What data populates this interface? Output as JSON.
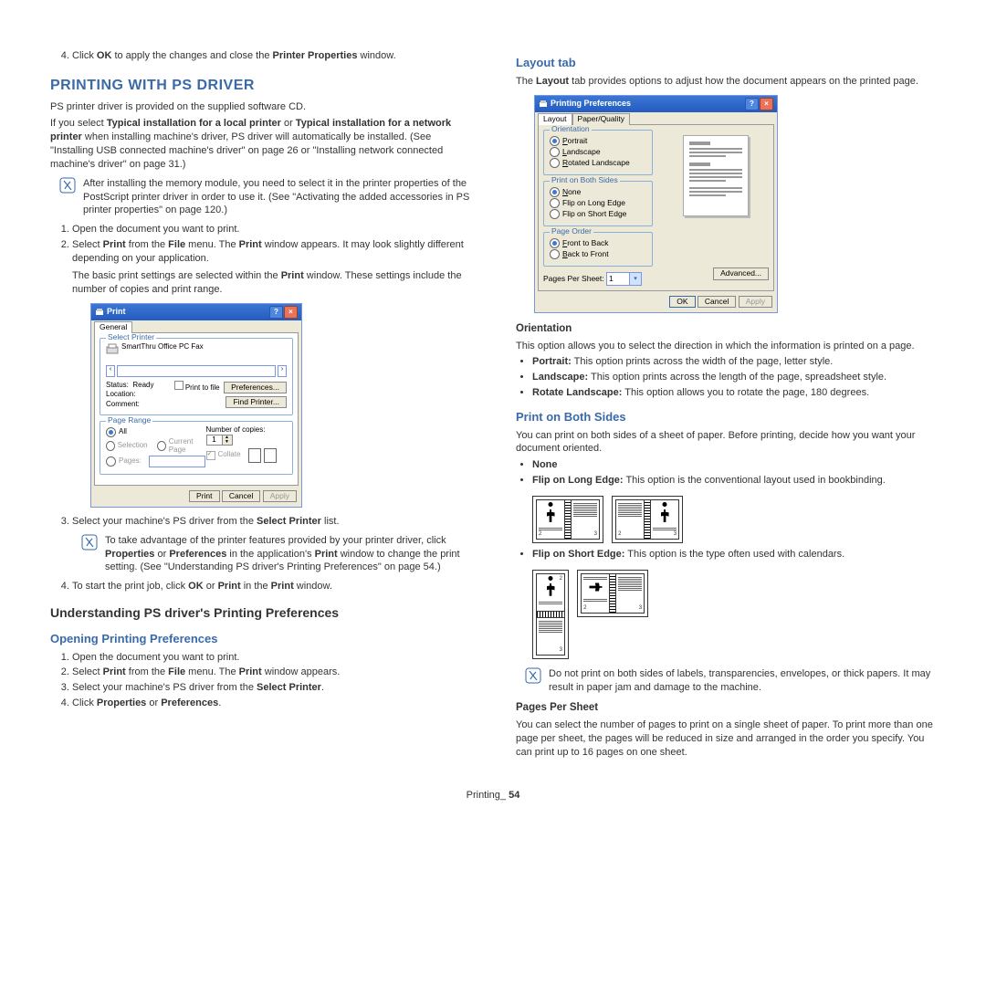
{
  "left": {
    "step4_pre": "Click ",
    "step4_ok": "OK",
    "step4_mid": " to apply the changes and close the ",
    "step4_pp": "Printer Properties",
    "step4_post": " window.",
    "h1": "PRINTING WITH PS DRIVER",
    "p1": "PS printer driver is provided on the supplied software CD.",
    "p2_a": "If you select ",
    "p2_b": "Typical installation for a local printer",
    "p2_c": " or ",
    "p2_d": "Typical installation for a network printer",
    "p2_e": " when installing machine's driver, PS driver will automatically be installed. (See \"Installing USB connected machine's driver\" on page 26 or \"Installing network connected machine's driver\" on page 31.)",
    "note1": "After installing the memory module, you need to select it in the printer properties of the PostScript printer driver in order to use it. (See \"Activating the added accessories in PS printer properties\" on page 120.)",
    "ol1_1": "Open the document you want to print.",
    "ol1_2a": "Select ",
    "ol1_2b": "Print",
    "ol1_2c": " from the ",
    "ol1_2d": "File",
    "ol1_2e": " menu. The ",
    "ol1_2f": "Print",
    "ol1_2g": " window appears. It may look slightly different depending on your application.",
    "ol1_2_sub_a": "The basic print settings are selected within the ",
    "ol1_2_sub_b": "Print",
    "ol1_2_sub_c": " window. These settings include the number of copies and print range.",
    "ol1_3a": "Select your machine's PS driver from the ",
    "ol1_3b": "Select Printer",
    "ol1_3c": " list.",
    "note2a": "To take advantage of the printer features provided by your printer driver, click ",
    "note2b": "Properties",
    "note2c": " or ",
    "note2d": "Preferences",
    "note2e": " in the application's ",
    "note2f": "Print",
    "note2g": " window to change the print setting. (See \"Understanding PS driver's Printing Preferences\" on page 54.)",
    "ol1_4a": "To start the print job, click ",
    "ol1_4b": "OK",
    "ol1_4c": " or ",
    "ol1_4d": "Print",
    "ol1_4e": " in the ",
    "ol1_4f": "Print",
    "ol1_4g": " window.",
    "h2": "Understanding PS driver's Printing Preferences",
    "h3": "Opening Printing Preferences",
    "o2_1": "Open the document you want to print.",
    "o2_2a": "Select ",
    "o2_2b": "Print",
    "o2_2c": " from the ",
    "o2_2d": "File",
    "o2_2e": " menu. The ",
    "o2_2f": "Print",
    "o2_2g": " window appears.",
    "o2_3a": "Select your machine's PS driver from the ",
    "o2_3b": "Select Printer",
    "o2_3c": ".",
    "o2_4a": "Click ",
    "o2_4b": "Properties",
    "o2_4c": " or ",
    "o2_4d": "Preferences",
    "o2_4e": "."
  },
  "print_dlg": {
    "title": "Print",
    "tab": "General",
    "grp_printer": "Select Printer",
    "printer_name": "SmartThru Office PC Fax",
    "status_l": "Status:",
    "status_v": "Ready",
    "loc_l": "Location:",
    "com_l": "Comment:",
    "ptf": "Print to file",
    "pref": "Preferences...",
    "find": "Find Printer...",
    "grp_range": "Page Range",
    "all": "All",
    "sel": "Selection",
    "cur": "Current Page",
    "pages": "Pages:",
    "copies_l": "Number of copies:",
    "copies_v": "1",
    "collate": "Collate",
    "b_print": "Print",
    "b_cancel": "Cancel",
    "b_apply": "Apply"
  },
  "right": {
    "h3_layout": "Layout tab",
    "p_layout_a": "The ",
    "p_layout_b": "Layout",
    "p_layout_c": " tab provides options to adjust how the document appears on the printed page.",
    "h4_orient": "Orientation",
    "p_orient": "This option allows you to select the direction in which the information is printed on a page.",
    "li_port_a": "Portrait:",
    "li_port_b": "  This option prints across the width of the page, letter style.",
    "li_land_a": "Landscape:",
    "li_land_b": "  This option prints across the length of the page, spreadsheet style.",
    "li_rot_a": "Rotate Landscape:",
    "li_rot_b": "  This option allows you to rotate the page, 180 degrees.",
    "h3_both": "Print on Both Sides",
    "p_both": "You can print on both sides of a sheet of paper. Before printing, decide how you want your document oriented.",
    "li_none": "None",
    "li_long_a": "Flip on Long Edge:",
    "li_long_b": "  This option is the conventional layout used in bookbinding.",
    "li_short_a": "Flip on Short Edge:",
    "li_short_b": "  This option is the type often used with calendars.",
    "note3": "Do not print on both sides of labels, transparencies, envelopes, or thick papers. It may result in paper jam and damage to the machine.",
    "h4_pps": "Pages Per Sheet",
    "p_pps": "You can select the number of pages to print on a single sheet of paper. To print more than one page per sheet, the pages will be reduced in size and arranged in the order you specify. You can print up to 16 pages on one sheet."
  },
  "pref_dlg": {
    "title": "Printing Preferences",
    "t1": "Layout",
    "t2": "Paper/Quality",
    "g_orient": "Orientation",
    "o1": "Portrait",
    "o2": "Landscape",
    "o3": "Rotated Landscape",
    "g_both": "Print on Both Sides",
    "b1": "None",
    "b2": "Flip on Long Edge",
    "b3": "Flip on Short Edge",
    "g_order": "Page Order",
    "po1": "Front to Back",
    "po2": "Back to Front",
    "pps_l": "Pages Per Sheet:",
    "pps_v": "1",
    "adv": "Advanced...",
    "ok": "OK",
    "cancel": "Cancel",
    "apply": "Apply"
  },
  "footer_a": "Printing",
  "footer_b": "_ ",
  "footer_c": "54"
}
